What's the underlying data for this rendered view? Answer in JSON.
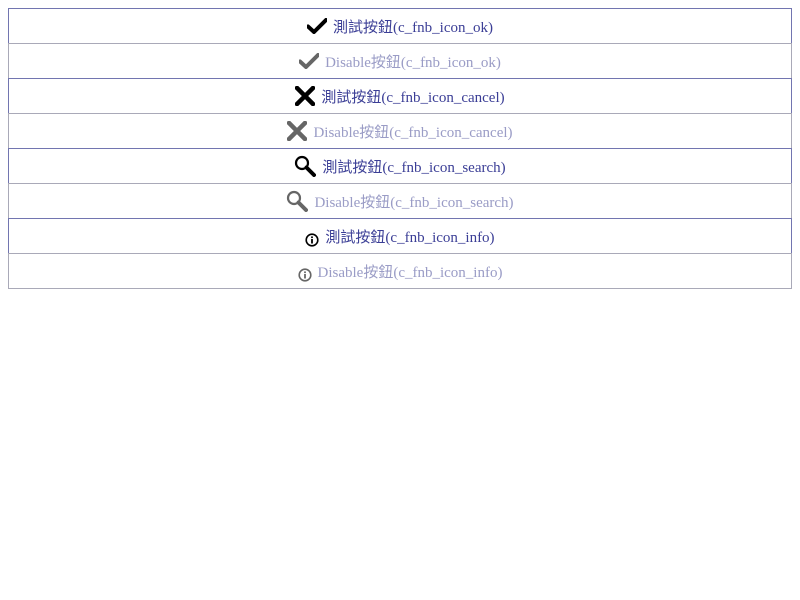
{
  "buttons": [
    {
      "label": "測試按鈕(c_fnb_icon_ok)",
      "icon": "check-icon",
      "enabled": true,
      "icon_color": "#000000"
    },
    {
      "label": "Disable按鈕(c_fnb_icon_ok)",
      "icon": "check-icon",
      "enabled": false,
      "icon_color": "#666666"
    },
    {
      "label": "測試按鈕(c_fnb_icon_cancel)",
      "icon": "cancel-icon",
      "enabled": true,
      "icon_color": "#000000"
    },
    {
      "label": "Disable按鈕(c_fnb_icon_cancel)",
      "icon": "cancel-icon",
      "enabled": false,
      "icon_color": "#666666"
    },
    {
      "label": "測試按鈕(c_fnb_icon_search)",
      "icon": "search-icon",
      "enabled": true,
      "icon_color": "#000000"
    },
    {
      "label": "Disable按鈕(c_fnb_icon_search)",
      "icon": "search-icon",
      "enabled": false,
      "icon_color": "#666666"
    },
    {
      "label": "測試按鈕(c_fnb_icon_info)",
      "icon": "info-icon",
      "enabled": true,
      "icon_color": "#000000"
    },
    {
      "label": "Disable按鈕(c_fnb_icon_info)",
      "icon": "info-icon",
      "enabled": false,
      "icon_color": "#666666"
    }
  ],
  "colors": {
    "enabled_text": "#3b3e96",
    "disabled_text": "#9a9cc6",
    "enabled_border": "#7275b0",
    "disabled_border": "#a9a9b8"
  }
}
